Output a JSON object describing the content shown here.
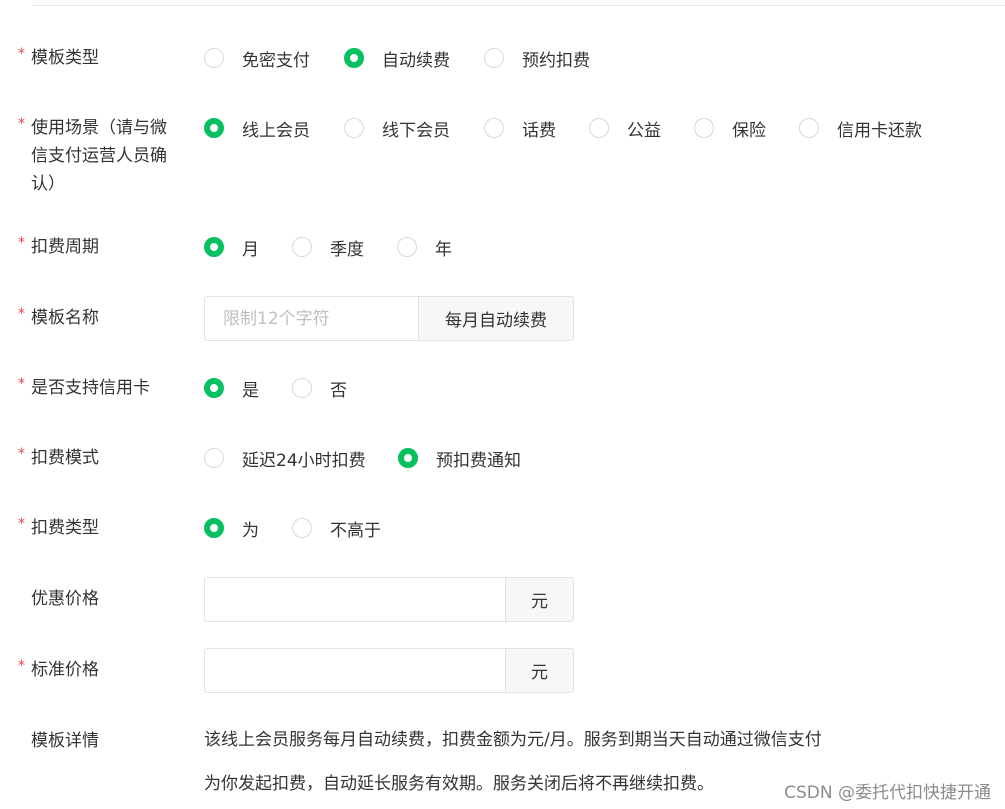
{
  "form": {
    "template_type": {
      "required": "*",
      "label": "模板类型",
      "options": [
        "免密支付",
        "自动续费",
        "预约扣费"
      ]
    },
    "scene": {
      "required": "*",
      "label": "使用场景（请与微信支付运营人员确认）",
      "options": [
        "线上会员",
        "线下会员",
        "话费",
        "公益",
        "保险",
        "信用卡还款"
      ]
    },
    "period": {
      "required": "*",
      "label": "扣费周期",
      "options": [
        "月",
        "季度",
        "年"
      ]
    },
    "template_name": {
      "required": "*",
      "label": "模板名称",
      "placeholder": "限制12个字符",
      "value": "",
      "addon": "每月自动续费"
    },
    "credit_card": {
      "required": "*",
      "label": "是否支持信用卡",
      "options": [
        "是",
        "否"
      ]
    },
    "deduct_mode": {
      "required": "*",
      "label": "扣费模式",
      "options": [
        "延迟24小时扣费",
        "预扣费通知"
      ]
    },
    "deduct_type": {
      "required": "*",
      "label": "扣费类型",
      "options": [
        "为",
        "不高于"
      ]
    },
    "discount_price": {
      "label": "优惠价格",
      "value": "",
      "addon": "元"
    },
    "standard_price": {
      "required": "*",
      "label": "标准价格",
      "value": "",
      "addon": "元"
    },
    "template_detail": {
      "label": "模板详情",
      "line1": "该线上会员服务每月自动续费，扣费金额为元/月。服务到期当天自动通过微信支付",
      "line2": "为你发起扣费，自动延长服务有效期。服务关闭后将不再继续扣费。"
    }
  },
  "watermark": "CSDN @委托代扣快捷开通",
  "colors": {
    "accent": "#07c160",
    "required": "#e54545"
  }
}
